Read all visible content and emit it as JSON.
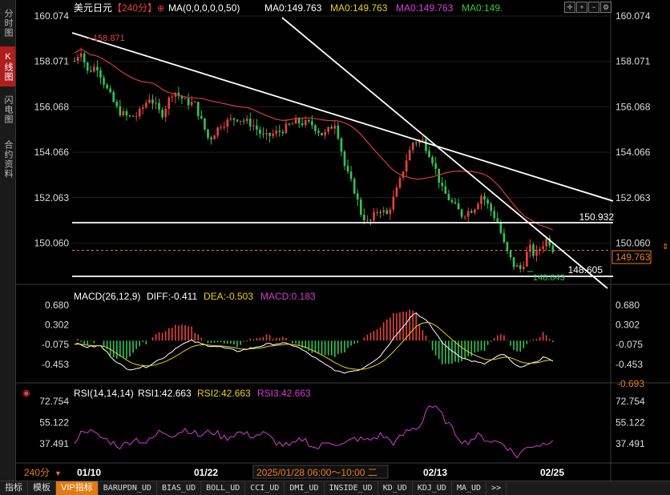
{
  "window": {
    "symbol": "美元日元",
    "period": "【240分】",
    "ma_params": "MA(0,0,0,0,0,50)",
    "ma_readouts": [
      {
        "text": "MA0:149.763",
        "color": "#ffffff"
      },
      {
        "text": "MA0:149.763",
        "color": "#e6d21a"
      },
      {
        "text": "MA0:149.763",
        "color": "#e03ce0"
      },
      {
        "text": "MA0:149.",
        "color": "#38c838"
      }
    ]
  },
  "left_tabs": [
    {
      "label": "分时图",
      "active": false
    },
    {
      "label": "K线图",
      "active": true
    },
    {
      "label": "闪电图",
      "active": false
    },
    {
      "label": "合约资料",
      "active": false
    }
  ],
  "toolbar_icons": [
    "crosshair-icon",
    "zoom-in-icon",
    "zoom-out-icon",
    "settings-icon"
  ],
  "price_panel": {
    "y_ticks": [
      "160.074",
      "158.071",
      "156.068",
      "154.066",
      "152.063",
      "150.060"
    ],
    "high_label": "158.871",
    "low_label": "148.843",
    "support_label": "148.605",
    "resistance_label": "150.932",
    "current_price": "149.763"
  },
  "macd_panel": {
    "title": "MACD(26,12,9)",
    "diff": "DIFF:-0.411",
    "dea": "DEA:-0.503",
    "macd": "MACD:0.183",
    "y_ticks": [
      "0.680",
      "0.302",
      "-0.075",
      "-0.453"
    ],
    "current": "-0.693"
  },
  "rsi_panel": {
    "title": "RSI(14,14,14)",
    "rsi1": "RSI1:42.663",
    "rsi2": "RSI2:42.663",
    "rsi3": "RSI3:42.663",
    "y_ticks": [
      "72.754",
      "55.122",
      "37.491"
    ]
  },
  "time_axis": {
    "period_badge": "240分",
    "dates": [
      "01/10",
      "01/22",
      "02/13",
      "02/25"
    ],
    "crosshair_time": "2025/01/28 06:00～10:00 二"
  },
  "bottom_tabs": [
    "指标",
    "模板",
    "VIP指标",
    "BARUPDN_UD",
    "BIAS_UD",
    "BOLL_UD",
    "CCI_UD",
    "DMI_UD",
    "INSIDE_UD",
    "KD_UD",
    "KDJ_UD",
    "MA_UD",
    ">>"
  ],
  "colors": {
    "up": "#e8433c",
    "down": "#2fc55a",
    "ma_line": "#d83a3a",
    "trendline": "#ffffff",
    "axis_text": "#dddddd",
    "diff_line": "#ffffff",
    "dea_line": "#e6d21a",
    "rsi_line": "#d63bd6",
    "current_price_box": "#e87b1f"
  }
}
